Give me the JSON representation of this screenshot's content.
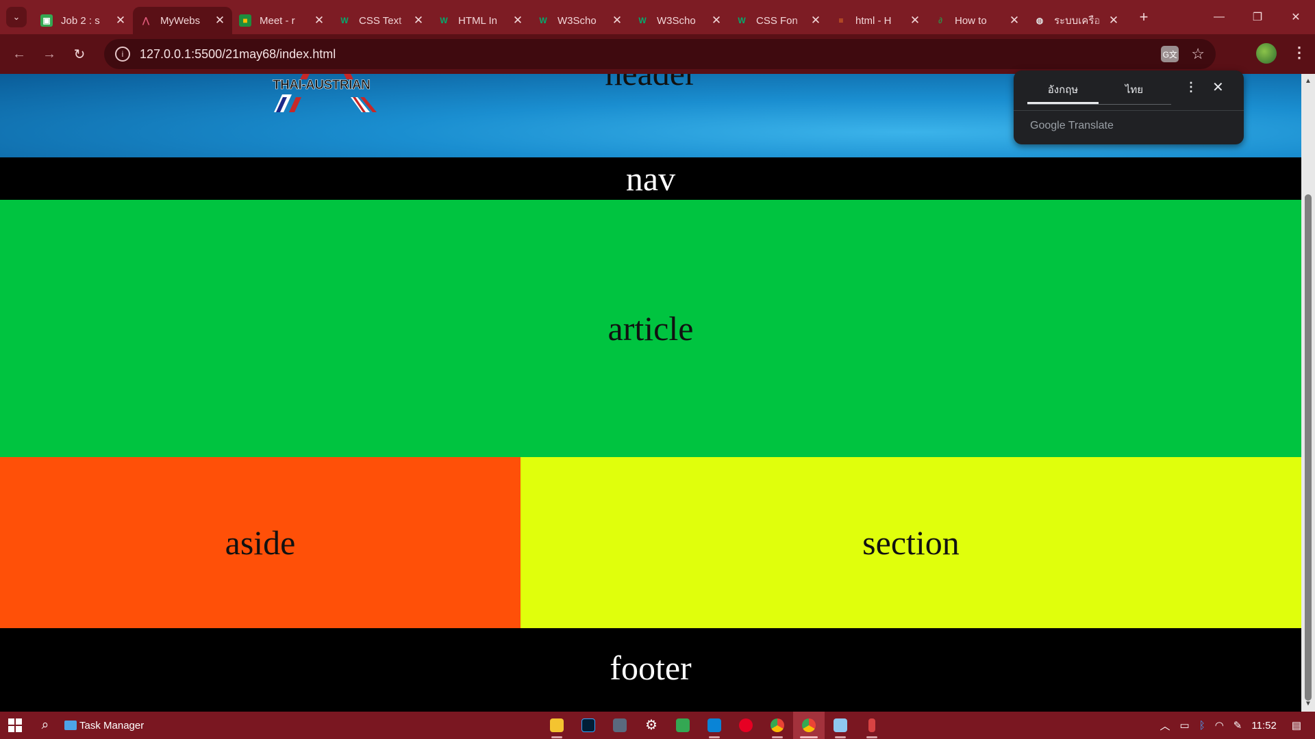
{
  "browser": {
    "tabs": [
      {
        "title": "Job 2 : s",
        "favicon": "classroom-icon",
        "color": "#34a853",
        "active": false
      },
      {
        "title": "MyWebs",
        "favicon": "thai-austrian-icon",
        "color": "#c2185b",
        "active": true
      },
      {
        "title": "Meet - r",
        "favicon": "meet-icon",
        "color": "#fbbc04",
        "active": false
      },
      {
        "title": "CSS Text",
        "favicon": "w3schools-icon",
        "color": "#04aa6d",
        "active": false
      },
      {
        "title": "HTML In",
        "favicon": "w3schools-icon",
        "color": "#04aa6d",
        "active": false
      },
      {
        "title": "W3Scho",
        "favicon": "w3schools-icon",
        "color": "#04aa6d",
        "active": false
      },
      {
        "title": "W3Scho",
        "favicon": "w3schools-icon",
        "color": "#04aa6d",
        "active": false
      },
      {
        "title": "CSS Fon",
        "favicon": "w3schools-icon",
        "color": "#04aa6d",
        "active": false
      },
      {
        "title": "html - H",
        "favicon": "stackoverflow-icon",
        "color": "#f48024",
        "active": false
      },
      {
        "title": "How to",
        "favicon": "geeksforgeeks-icon",
        "color": "#2f8d46",
        "active": false
      },
      {
        "title": "ระบบเครือ",
        "favicon": "globe-icon",
        "color": "#e0e0e0",
        "active": false
      }
    ],
    "url": "127.0.0.1:5500/21may68/index.html"
  },
  "page": {
    "header": "header",
    "logo_text": "THAI-AUSTRIAN",
    "nav": "nav",
    "article": "article",
    "aside": "aside",
    "section": "section",
    "footer": "footer"
  },
  "translate_popup": {
    "tab_source": "อังกฤษ",
    "tab_target": "ไทย",
    "brand": "Google Translate"
  },
  "taskbar": {
    "app_label": "Task Manager",
    "time": "11:52",
    "pinned": [
      "file-explorer-icon",
      "photoshop-icon",
      "calculator-icon",
      "settings-icon",
      "sheets-icon",
      "vscode-icon",
      "pinterest-icon",
      "chrome-icon",
      "chrome-icon",
      "notepad-icon",
      "paint-icon"
    ]
  },
  "colors": {
    "article": "#00c440",
    "aside": "#ff5008",
    "section": "#e0ff0c",
    "nav": "#000000",
    "footer": "#000000",
    "header": "#1a8ed0"
  }
}
